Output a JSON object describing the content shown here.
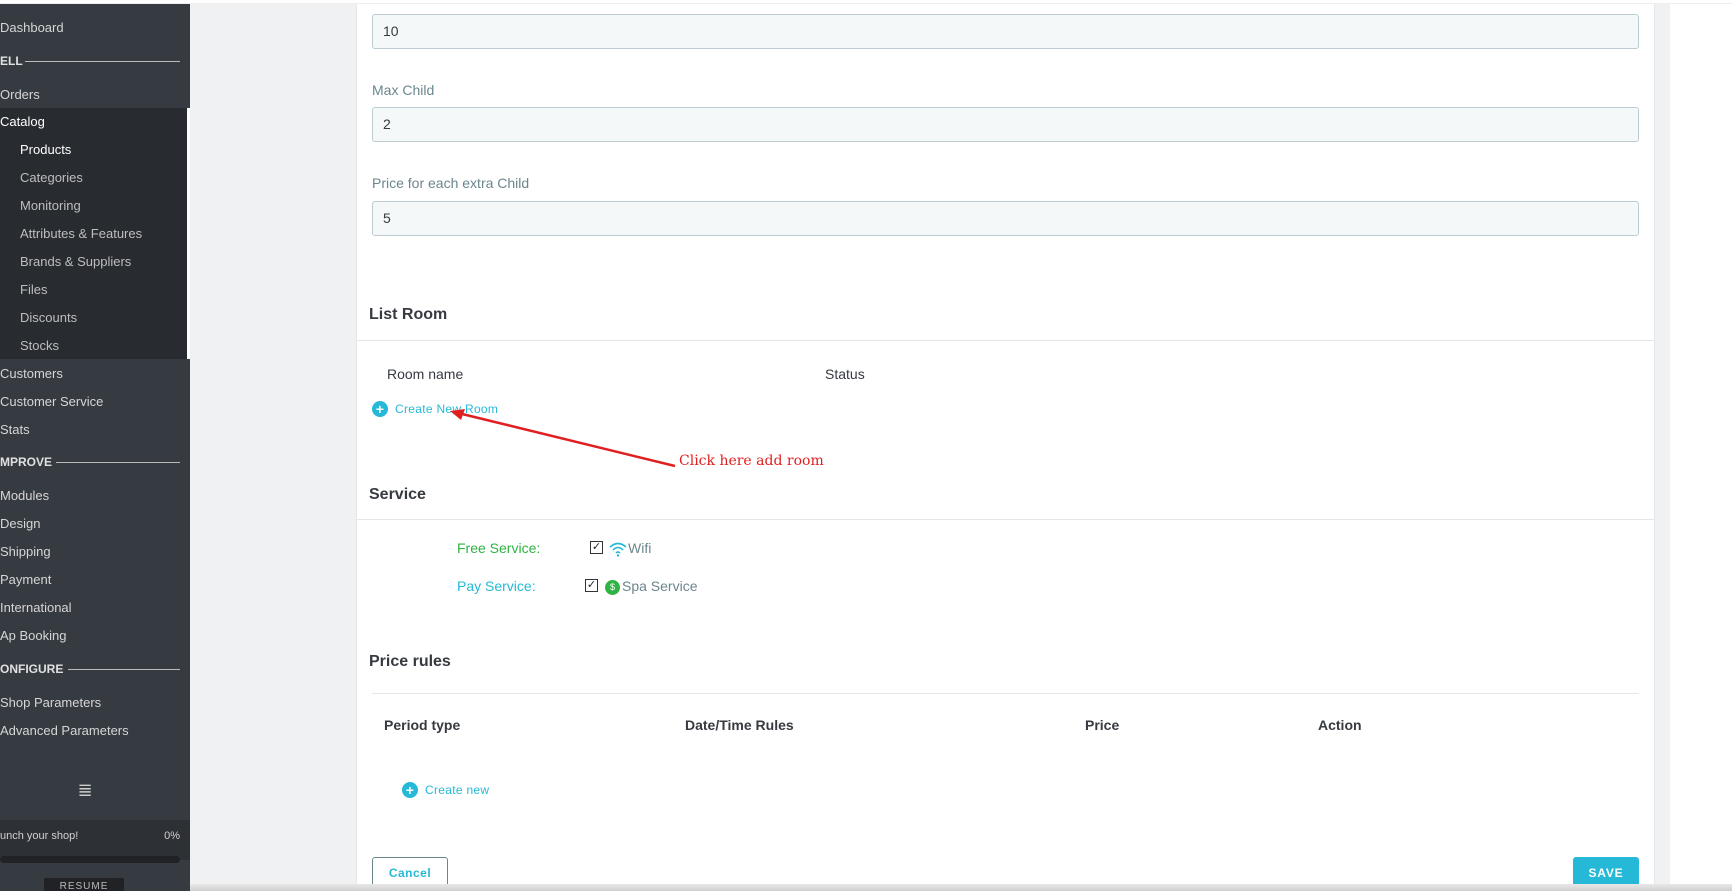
{
  "sidebar": {
    "dashboard": "Dashboard",
    "sell_title": "ELL",
    "orders": "Orders",
    "catalog": "Catalog",
    "catalog_items": [
      "Products",
      "Categories",
      "Monitoring",
      "Attributes & Features",
      "Brands & Suppliers",
      "Files",
      "Discounts",
      "Stocks"
    ],
    "customers": "Customers",
    "customer_service": "Customer Service",
    "stats": "Stats",
    "improve_title": "MPROVE",
    "improve_items": [
      "Modules",
      "Design",
      "Shipping",
      "Payment",
      "International",
      "Ap Booking"
    ],
    "configure_title": "ONFIGURE",
    "configure_items": [
      "Shop Parameters",
      "Advanced Parameters"
    ],
    "collapse_glyph": "≣",
    "launch_text": "unch your shop!",
    "launch_pct": "0%",
    "launch_progress": 0,
    "resume_label": "RESUME"
  },
  "form": {
    "first_value": "10",
    "max_child_label": "Max Child",
    "max_child_value": "2",
    "extra_child_label": "Price for each extra Child",
    "extra_child_value": "5"
  },
  "list_room": {
    "title": "List Room",
    "col_room_name": "Room name",
    "col_status": "Status",
    "create_label": "Create New Room"
  },
  "annotation": {
    "text": "Click here add room",
    "color": "#e02020"
  },
  "service": {
    "title": "Service",
    "free_label": "Free Service:",
    "free_item": "Wifi",
    "free_checked": true,
    "pay_label": "Pay Service:",
    "pay_item": "Spa Service",
    "pay_checked": true,
    "check_glyph": "✓",
    "spa_glyph": "$"
  },
  "price_rules": {
    "title": "Price rules",
    "columns": [
      "Period type",
      "Date/Time Rules",
      "Price",
      "Action"
    ],
    "create_label": "Create new"
  },
  "footer": {
    "cancel_label": "Cancel",
    "save_label": "SAVE"
  },
  "colors": {
    "accent": "#25b9d7",
    "sidebar_bg": "#363a41",
    "free_green": "#2fb344"
  }
}
